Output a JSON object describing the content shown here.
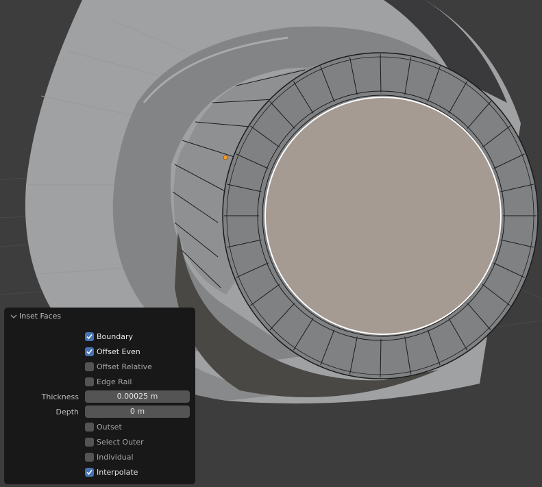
{
  "viewport": {
    "description": "3D viewport showing a cylindrical mesh with inset faces in edit mode",
    "colors": {
      "background": "#3d3d3d",
      "mesh_light": "#a2a4a5",
      "mesh_mid": "#848587",
      "selected_face": "#a59b92",
      "selected_edge": "#ffffff",
      "active_vertex": "#ff9a1f"
    }
  },
  "operator_panel": {
    "title": "Inset Faces",
    "accent_color": "#4772b3",
    "options": [
      {
        "label": "Boundary",
        "checked": true
      },
      {
        "label": "Offset Even",
        "checked": true
      },
      {
        "label": "Offset Relative",
        "checked": false
      },
      {
        "label": "Edge Rail",
        "checked": false
      }
    ],
    "thickness": {
      "label": "Thickness",
      "value": "0.00025 m"
    },
    "depth": {
      "label": "Depth",
      "value": "0 m"
    },
    "options2": [
      {
        "label": "Outset",
        "checked": false
      },
      {
        "label": "Select Outer",
        "checked": false
      },
      {
        "label": "Individual",
        "checked": false
      },
      {
        "label": "Interpolate",
        "checked": true
      }
    ]
  }
}
